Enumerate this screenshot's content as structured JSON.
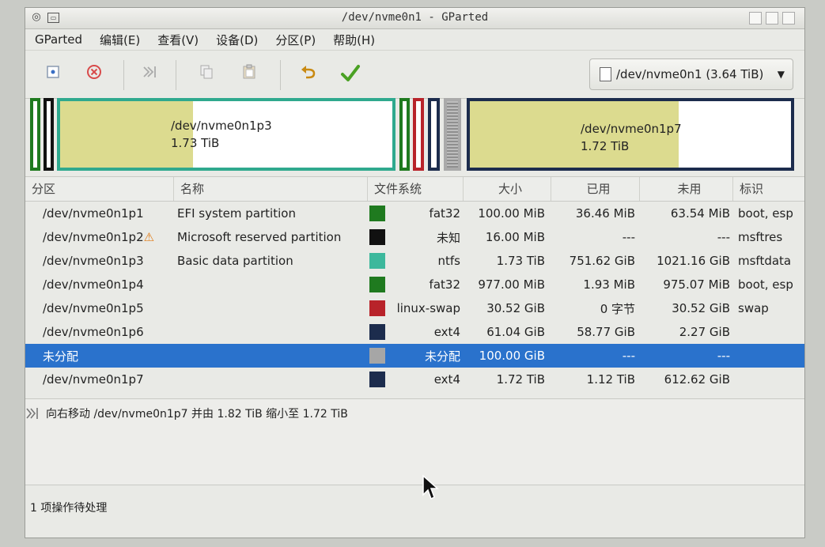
{
  "window": {
    "title": "/dev/nvme0n1 - GParted"
  },
  "menu": [
    "GParted",
    "编辑(E)",
    "查看(V)",
    "设备(D)",
    "分区(P)",
    "帮助(H)"
  ],
  "toolbar": {
    "device": "/dev/nvme0n1 (3.64 TiB)"
  },
  "diskmap": {
    "p3": {
      "name": "/dev/nvme0n1p3",
      "size": "1.73 TiB",
      "used_fraction": 0.4,
      "color": "#2fa98e"
    },
    "p7": {
      "name": "/dev/nvme0n1p7",
      "size": "1.72 TiB",
      "used_fraction": 0.65,
      "color": "#1c2c4d"
    }
  },
  "table": {
    "headers": [
      "分区",
      "名称",
      "文件系统",
      "大小",
      "已用",
      "未用",
      "标识"
    ],
    "rows": [
      {
        "partition": "/dev/nvme0n1p1",
        "name": "EFI system partition",
        "fs": "fat32",
        "fs_color": "#1f7a1f",
        "size": "100.00 MiB",
        "used": "36.46 MiB",
        "unused": "63.54 MiB",
        "flags": "boot, esp"
      },
      {
        "partition": "/dev/nvme0n1p2",
        "name": "Microsoft reserved partition",
        "fs": "未知",
        "fs_color": "#111111",
        "size": "16.00 MiB",
        "used": "---",
        "unused": "---",
        "flags": "msftres"
      },
      {
        "partition": "/dev/nvme0n1p3",
        "name": "Basic data partition",
        "fs": "ntfs",
        "fs_color": "#3cb89c",
        "size": "1.73 TiB",
        "used": "751.62 GiB",
        "unused": "1021.16 GiB",
        "flags": "msftdata"
      },
      {
        "partition": "/dev/nvme0n1p4",
        "name": "",
        "fs": "fat32",
        "fs_color": "#1f7a1f",
        "size": "977.00 MiB",
        "used": "1.93 MiB",
        "unused": "975.07 MiB",
        "flags": "boot, esp"
      },
      {
        "partition": "/dev/nvme0n1p5",
        "name": "",
        "fs": "linux-swap",
        "fs_color": "#b8232a",
        "size": "30.52 GiB",
        "used": "0 字节",
        "unused": "30.52 GiB",
        "flags": "swap"
      },
      {
        "partition": "/dev/nvme0n1p6",
        "name": "",
        "fs": "ext4",
        "fs_color": "#1c2c4d",
        "size": "61.04 GiB",
        "used": "58.77 GiB",
        "unused": "2.27 GiB",
        "flags": ""
      },
      {
        "partition": "未分配",
        "name": "",
        "fs": "未分配",
        "fs_color": "#a6a6a6",
        "size": "100.00 GiB",
        "used": "---",
        "unused": "---",
        "flags": ""
      },
      {
        "partition": "/dev/nvme0n1p7",
        "name": "",
        "fs": "ext4",
        "fs_color": "#1c2c4d",
        "size": "1.72 TiB",
        "used": "1.12 TiB",
        "unused": "612.62 GiB",
        "flags": ""
      }
    ]
  },
  "operations": [
    "向右移动 /dev/nvme0n1p7 并由 1.82 TiB 缩小至 1.72 TiB"
  ],
  "status": "1 项操作待处理"
}
